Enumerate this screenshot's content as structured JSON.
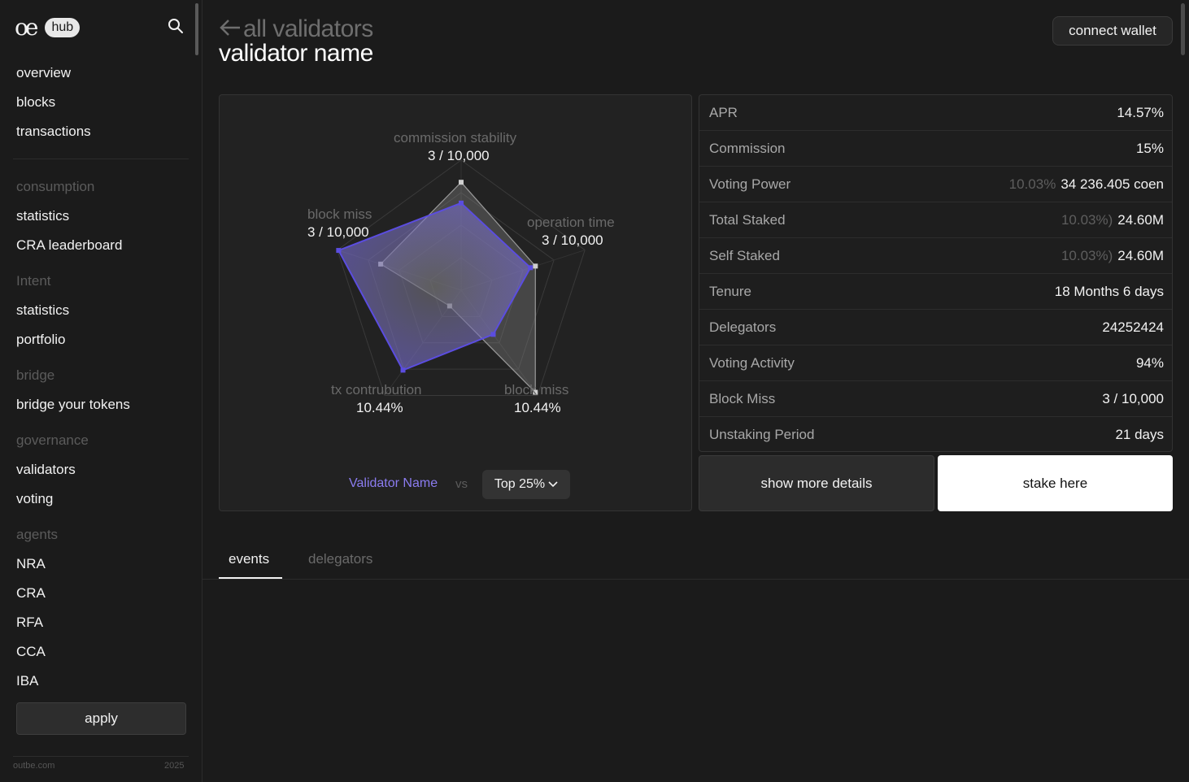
{
  "brand": {
    "logo": "oe",
    "badge": "hub"
  },
  "sidebar": {
    "main_items": [
      "overview",
      "blocks",
      "transactions"
    ],
    "sections": [
      {
        "title": "consumption",
        "items": [
          "statistics",
          "CRA leaderboard"
        ]
      },
      {
        "title": "Intent",
        "items": [
          "statistics",
          "portfolio"
        ]
      },
      {
        "title": "bridge",
        "items": [
          "bridge your tokens"
        ]
      },
      {
        "title": "governance",
        "items": [
          "validators",
          "voting"
        ]
      },
      {
        "title": "agents",
        "items": [
          "NRA",
          "CRA",
          "RFA",
          "CCA",
          "IBA"
        ]
      }
    ],
    "apply_label": "apply",
    "footer_left": "outbe.com",
    "footer_right": "2025"
  },
  "header": {
    "back_label": "all validators",
    "title": "validator name",
    "connect_label": "connect wallet"
  },
  "radar": {
    "axes": [
      {
        "label": "commission stability",
        "value": "3 / 10,000"
      },
      {
        "label": "operation time",
        "value": "3 / 10,000"
      },
      {
        "label": "block miss",
        "value": "10.44%"
      },
      {
        "label": "tx contrubution",
        "value": "10.44%"
      },
      {
        "label": "block miss",
        "value": "3 / 10,000"
      }
    ],
    "validator_fractions": [
      0.67,
      0.56,
      0.42,
      0.76,
      0.99
    ],
    "top_fractions": [
      0.83,
      0.6,
      0.97,
      0.15,
      0.65
    ],
    "validator_color": "#5b4de0",
    "legend_validator": "Validator Name",
    "legend_vs": "vs",
    "compare_value": "Top 25%"
  },
  "stats": [
    {
      "label": "APR",
      "muted": "",
      "value": "14.57%"
    },
    {
      "label": "Commission",
      "muted": "",
      "value": "15%"
    },
    {
      "label": "Voting Power",
      "muted": "10.03%",
      "value": "34 236.405 coen"
    },
    {
      "label": "Total Staked",
      "muted": "10.03%)",
      "value": "24.60M"
    },
    {
      "label": "Self Staked",
      "muted": "10.03%)",
      "value": "24.60M"
    },
    {
      "label": "Tenure",
      "muted": "",
      "value": "18 Months 6 days"
    },
    {
      "label": "Delegators",
      "muted": "",
      "value": "24252424"
    },
    {
      "label": "Voting Activity",
      "muted": "",
      "value": "94%"
    },
    {
      "label": "Block Miss",
      "muted": "",
      "value": "3 / 10,000"
    },
    {
      "label": "Unstaking Period",
      "muted": "",
      "value": "21 days"
    }
  ],
  "actions": {
    "details_label": "show more details",
    "stake_label": "stake here"
  },
  "tabs": [
    {
      "label": "events",
      "active": true
    },
    {
      "label": "delegators",
      "active": false
    }
  ]
}
